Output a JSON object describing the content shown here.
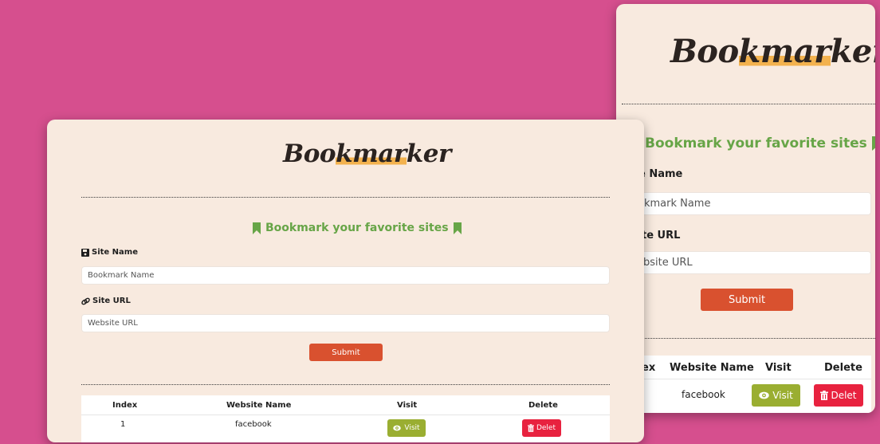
{
  "app": {
    "logo_part1": "Boo",
    "logo_part2": "kmar",
    "logo_part3": "ker",
    "heading": "Bookmark your favorite sites",
    "site_name_label": "Site Name",
    "site_name_placeholder": "Bookmark Name",
    "site_url_label": "Site URL",
    "site_url_placeholder": "Website URL",
    "submit_label": "Submit",
    "table": {
      "headers": [
        "Index",
        "Website Name",
        "Visit",
        "Delete"
      ],
      "rows": [
        {
          "index": "1",
          "name": "facebook",
          "visit_label": "Visit",
          "delete_label": "Delet"
        }
      ]
    }
  },
  "back_card": {
    "site_name_label_visible": "e Name",
    "site_name_placeholder_visible": "okmark Name",
    "site_url_label_visible": "te URL",
    "site_url_placeholder_visible": "bsite URL",
    "index_header_visible": "ex"
  },
  "icons": {
    "heading": "bookmark-icon",
    "site_name": "save-icon",
    "site_url": "link-icon",
    "visit": "eye-icon",
    "delete": "trash-icon"
  },
  "colors": {
    "page_background": "#d64f8e",
    "card_background": "#f8eadf",
    "heading": "#67a547",
    "submit": "#d9512f",
    "visit": "#9aae31",
    "delete": "#e8223f",
    "logo_highlight": "#f3b24e"
  }
}
